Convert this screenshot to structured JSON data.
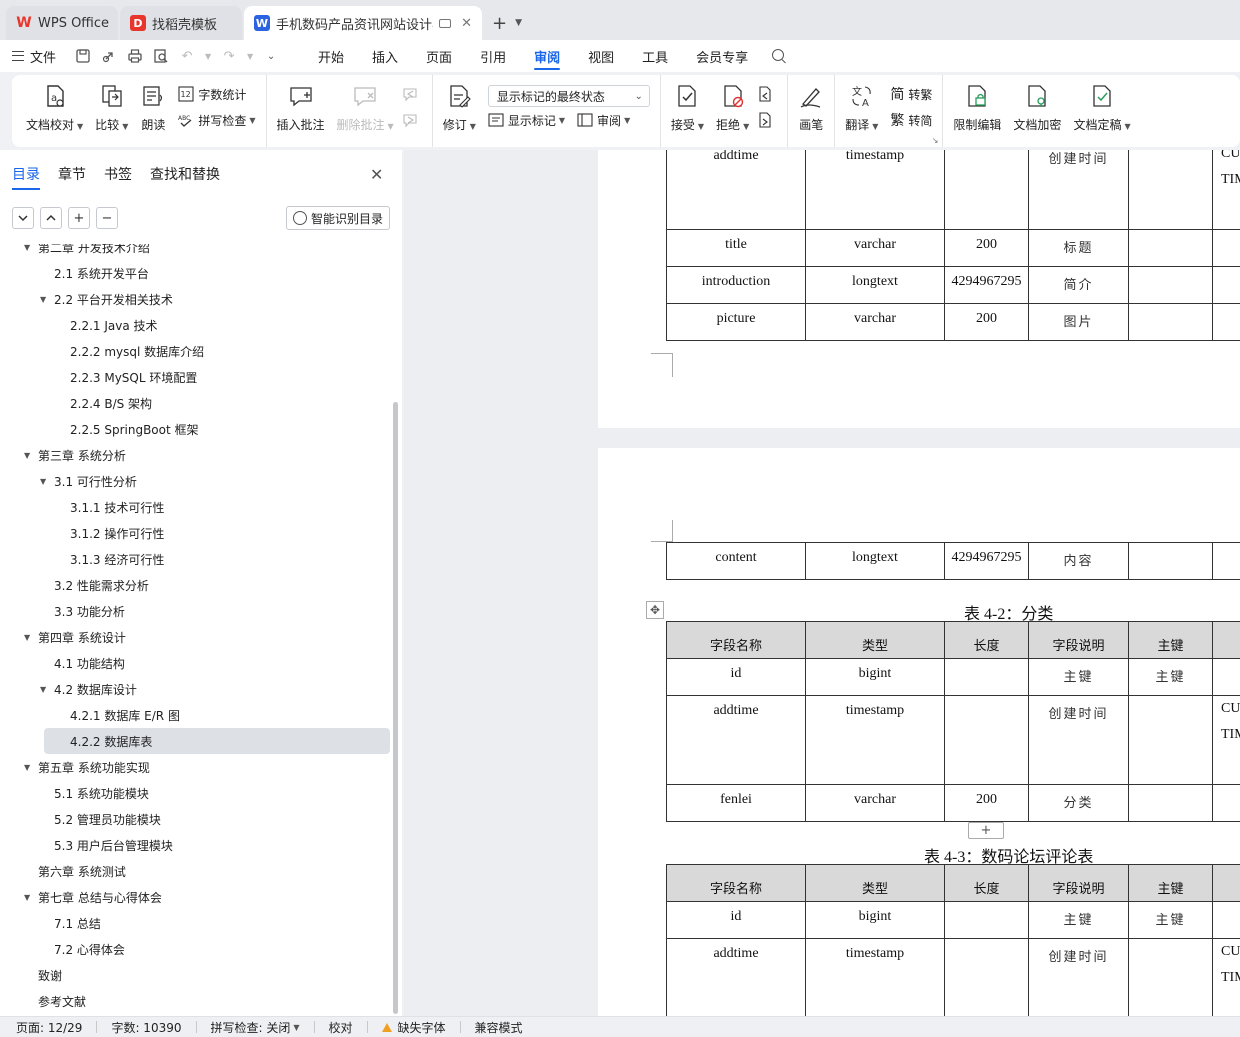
{
  "tabs": [
    {
      "label": "WPS Office",
      "logo": "W",
      "color": "#e8362d"
    },
    {
      "label": "找稻壳模板",
      "logo": "D",
      "color": "#e8362d"
    },
    {
      "label": "手机数码产品资讯网站设计与实",
      "logo": "W",
      "color": "#2b63e0"
    }
  ],
  "menu": {
    "file": "文件",
    "items": [
      "开始",
      "插入",
      "页面",
      "引用",
      "审阅",
      "视图",
      "工具",
      "会员专享"
    ],
    "active": "审阅"
  },
  "ribbon": {
    "doc_check": "文档校对",
    "compare": "比较",
    "read_aloud": "朗读",
    "word_count": "字数统计",
    "spell_check": "拼写检查",
    "insert_comment": "插入批注",
    "delete_comment": "删除批注",
    "revise": "修订",
    "markup_state": "显示标记的最终状态",
    "show_markup": "显示标记",
    "review": "审阅",
    "accept": "接受",
    "reject": "拒绝",
    "pen": "画笔",
    "translate": "翻译",
    "to_traditional": "转繁",
    "to_simplified": "转简",
    "restrict_edit": "限制编辑",
    "doc_encrypt": "文档加密",
    "doc_finalize": "文档定稿"
  },
  "sidebar": {
    "tabs": [
      "目录",
      "章节",
      "书签",
      "查找和替换"
    ],
    "smart_toc": "智能识别目录",
    "toc": [
      {
        "label": "第二章  开发技术介绍",
        "level": 1,
        "arrow": "down"
      },
      {
        "label": "2.1  系统开发平台",
        "level": 2
      },
      {
        "label": "2.2  平台开发相关技术",
        "level": 2,
        "arrow": "down"
      },
      {
        "label": "2.2.1 Java 技术",
        "level": 3
      },
      {
        "label": "2.2.2 mysql 数据库介绍",
        "level": 3
      },
      {
        "label": "2.2.3 MySQL 环境配置",
        "level": 3
      },
      {
        "label": "2.2.4 B/S 架构",
        "level": 3
      },
      {
        "label": "2.2.5 SpringBoot 框架",
        "level": 3
      },
      {
        "label": "第三章  系统分析",
        "level": 1,
        "arrow": "down"
      },
      {
        "label": "3.1  可行性分析",
        "level": 2,
        "arrow": "down"
      },
      {
        "label": "3.1.1 技术可行性",
        "level": 3
      },
      {
        "label": "3.1.2 操作可行性",
        "level": 3
      },
      {
        "label": "3.1.3  经济可行性",
        "level": 3
      },
      {
        "label": "3.2 性能需求分析",
        "level": 2
      },
      {
        "label": "3.3 功能分析",
        "level": 2
      },
      {
        "label": "第四章  系统设计",
        "level": 1,
        "arrow": "down"
      },
      {
        "label": "4.1 功能结构",
        "level": 2
      },
      {
        "label": "4.2  数据库设计",
        "level": 2,
        "arrow": "down"
      },
      {
        "label": "4.2.1  数据库 E/R 图",
        "level": 3
      },
      {
        "label": "4.2.2  数据库表",
        "level": 3,
        "selected": true
      },
      {
        "label": "第五章  系统功能实现",
        "level": 1,
        "arrow": "down"
      },
      {
        "label": "5.1 系统功能模块",
        "level": 2
      },
      {
        "label": "5.2  管理员功能模块",
        "level": 2
      },
      {
        "label": "5.3  用户后台管理模块",
        "level": 2
      },
      {
        "label": "第六章  系统测试",
        "level": 1
      },
      {
        "label": "第七章  总结与心得体会",
        "level": 1,
        "arrow": "down"
      },
      {
        "label": "7.1  总结",
        "level": 2
      },
      {
        "label": "7.2  心得体会",
        "level": 2
      },
      {
        "label": "致谢",
        "level": 1
      },
      {
        "label": "参考文献",
        "level": 1
      }
    ]
  },
  "document": {
    "page1_rows": [
      [
        "addtime",
        "timestamp",
        "",
        "创建时间",
        "",
        "CU|TIM"
      ],
      [
        "title",
        "varchar",
        "200",
        "标题",
        "",
        ""
      ],
      [
        "introduction",
        "longtext",
        "4294967295",
        "简介",
        "",
        ""
      ],
      [
        "picture",
        "varchar",
        "200",
        "图片",
        "",
        ""
      ]
    ],
    "page2_rows": [
      [
        "content",
        "longtext",
        "4294967295",
        "内容",
        "",
        ""
      ]
    ],
    "table2_caption": "表 4-2：分类",
    "table3_caption": "表 4-3：数码论坛评论表",
    "header": [
      "字段名称",
      "类型",
      "长度",
      "字段说明",
      "主键",
      ""
    ],
    "table2_rows": [
      [
        "id",
        "bigint",
        "",
        "主键",
        "主键",
        ""
      ],
      [
        "addtime",
        "timestamp",
        "",
        "创建时间",
        "",
        "CU|TIM"
      ],
      [
        "fenlei",
        "varchar",
        "200",
        "分类",
        "",
        ""
      ]
    ],
    "table3_rows": [
      [
        "id",
        "bigint",
        "",
        "主键",
        "主键",
        ""
      ],
      [
        "addtime",
        "timestamp",
        "",
        "创建时间",
        "",
        "CU|TIM"
      ]
    ]
  },
  "status": {
    "page": "页面: 12/29",
    "words": "字数: 10390",
    "spell": "拼写检查: 关闭",
    "proof": "校对",
    "missing_font": "缺失字体",
    "compat": "兼容模式"
  }
}
